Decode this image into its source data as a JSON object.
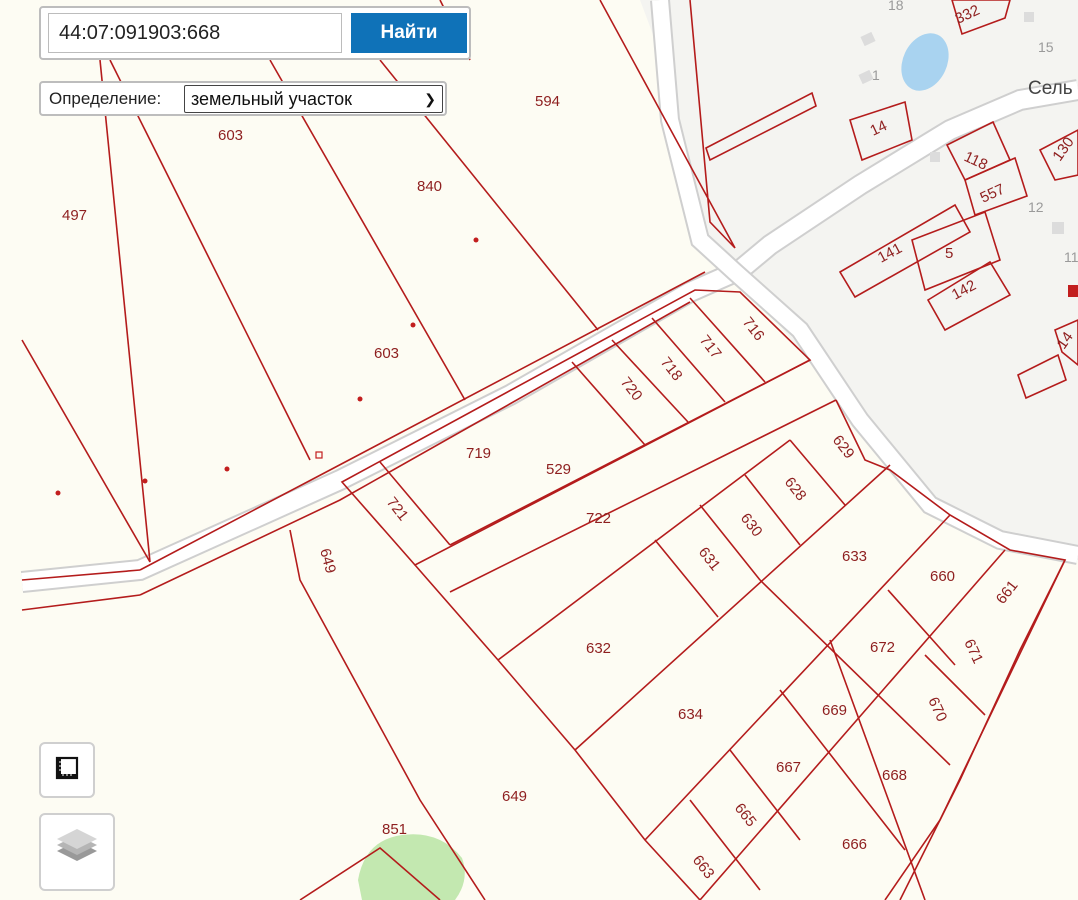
{
  "search": {
    "value": "44:07:091903:668",
    "button_label": "Найти"
  },
  "definition": {
    "label": "Определение:",
    "selected": "земельный участок"
  },
  "map": {
    "place_name": "Сель",
    "parcel_labels": {
      "p497": "497",
      "p603a": "603",
      "p594": "594",
      "p840": "840",
      "p603b": "603",
      "p719": "719",
      "p529": "529",
      "p720": "720",
      "p718": "718",
      "p717": "717",
      "p716": "716",
      "p721": "721",
      "p722": "722",
      "p649a": "649",
      "p649b": "649",
      "p629": "629",
      "p628": "628",
      "p630": "630",
      "p631": "631",
      "p633": "633",
      "p632": "632",
      "p634": "634",
      "p660": "660",
      "p661": "661",
      "p671": "671",
      "p672": "672",
      "p669": "669",
      "p670": "670",
      "p667": "667",
      "p668": "668",
      "p665": "665",
      "p666": "666",
      "p663": "663",
      "p851": "851",
      "b14": "14",
      "b118": "118",
      "b557": "557",
      "b141": "141",
      "b5": "5",
      "b142": "142",
      "b332": "332",
      "b130": "130",
      "b14r": "14"
    },
    "house_numbers": {
      "h18": "18",
      "h15": "15",
      "h1": "1",
      "h12": "12",
      "h11": "11"
    },
    "colors": {
      "parcel_line": "#b41c1c",
      "label": "#8e1f1f",
      "background": "#fdfcf3",
      "water": "#a9d3f0",
      "forest": "#c3e8b0",
      "road": "#ffffff"
    }
  },
  "controls": {
    "measure": "ruler-icon",
    "layers": "layers-icon"
  }
}
